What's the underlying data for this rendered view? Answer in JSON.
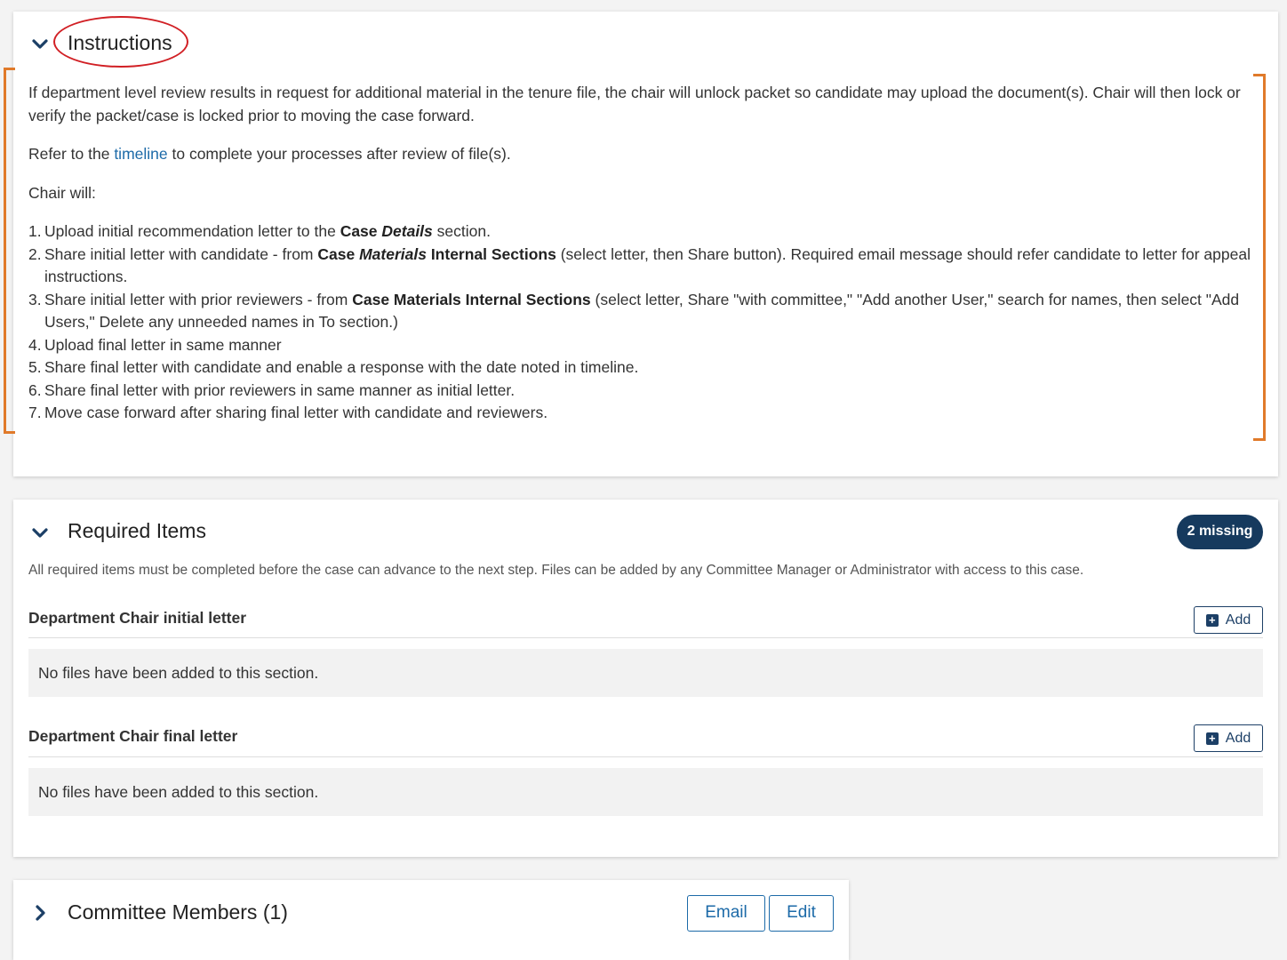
{
  "instructions": {
    "title": "Instructions",
    "para1": "If department level review results in request for additional material in the tenure file, the chair will unlock packet so candidate may upload the document(s).  Chair will then lock or verify the packet/case is locked prior to moving the case forward.",
    "refer_prefix": "Refer to the ",
    "refer_link": "timeline",
    "refer_suffix": " to complete your processes after review of file(s).",
    "chair_will": "Chair will:",
    "steps": [
      {
        "num": "1.",
        "t1": "Upload initial recommendation letter to the ",
        "b1": "Case ",
        "bi1": "Details",
        "t2": " section."
      },
      {
        "num": "2.",
        "t1": "Share initial letter with candidate - from ",
        "b1": "Case ",
        "bi1": "Materials",
        "b2": " Internal Sections",
        "t2": " (select letter, then Share button). Required email message should refer candidate to letter for appeal instructions."
      },
      {
        "num": "3.",
        "t1": "Share initial letter with prior reviewers - from ",
        "b1": "Case Materials Internal Sections",
        "t2": " (select letter, Share \"with committee,\" \"Add another User,\" search for names, then select \"Add Users,\" Delete any unneeded names in To section.)"
      },
      {
        "num": "4.",
        "t1": "Upload final letter in same manner"
      },
      {
        "num": "5.",
        "t1": "Share final letter with candidate and enable a response with the date noted in timeline."
      },
      {
        "num": "6.",
        "t1": "Share final letter with prior reviewers in same manner as initial letter."
      },
      {
        "num": "7.",
        "t1": "Move case forward after sharing final letter with candidate and reviewers."
      }
    ]
  },
  "required": {
    "title": "Required Items",
    "badge": "2 missing",
    "description": "All required items must be completed before the case can advance to the next step. Files can be added by any Committee Manager or Administrator with access to this case.",
    "sections": [
      {
        "label": "Department Chair initial letter",
        "add_label": "Add",
        "empty_text": "No files have been added to this section."
      },
      {
        "label": "Department Chair final letter",
        "add_label": "Add",
        "empty_text": "No files have been added to this section."
      }
    ]
  },
  "committee": {
    "title": "Committee Members (1)",
    "email_label": "Email",
    "edit_label": "Edit"
  },
  "colors": {
    "accent": "#1c6aa8",
    "navy": "#163a5e",
    "annotation_circle": "#d11f24",
    "annotation_bracket": "#e07a2a"
  },
  "icons": {
    "collapse": "chevron-down-icon",
    "expand": "chevron-right-icon",
    "add": "plus-square-icon"
  }
}
